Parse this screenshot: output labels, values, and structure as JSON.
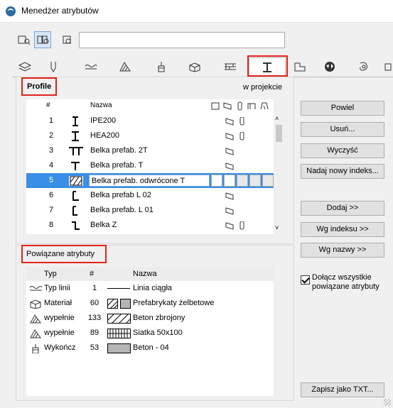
{
  "window": {
    "title": "Menedżer atrybutów"
  },
  "profiles": {
    "title": "Profile",
    "location_label": "w projekcie",
    "columns": {
      "num": "#",
      "name": "Nazwa"
    },
    "rows": [
      {
        "num": "1",
        "name": "IPE200",
        "icon": "i-beam-profile-icon"
      },
      {
        "num": "2",
        "name": "HEA200",
        "icon": "h-beam-profile-icon"
      },
      {
        "num": "3",
        "name": "Belka prefab. 2T",
        "icon": "double-t-profile-icon"
      },
      {
        "num": "4",
        "name": "Belka prefab. T",
        "icon": "t-profile-icon"
      },
      {
        "num": "5",
        "name": "Belka prefab. odwrócone T",
        "icon": "hatched-profile-icon",
        "selected": true
      },
      {
        "num": "6",
        "name": "Belka prefab L 02",
        "icon": "l-profile-icon"
      },
      {
        "num": "7",
        "name": "Belka prefab. L 01",
        "icon": "l-profile-icon"
      },
      {
        "num": "8",
        "name": "Belka Z",
        "icon": "z-profile-icon"
      }
    ]
  },
  "buttons": {
    "duplicate": "Powiel",
    "delete": "Usuń...",
    "clear": "Wyczyść",
    "reindex": "Nadaj nowy indeks...",
    "add": "Dodaj >>",
    "by_index": "Wg indeksu >>",
    "by_name": "Wg nazwy >>",
    "save_txt": "Zapisz jako TXT..."
  },
  "related": {
    "title": "Powiązane atrybuty",
    "columns": {
      "type": "Typ",
      "num": "#",
      "name": "Nazwa"
    },
    "rows": [
      {
        "type": "Typ linii",
        "num": "1",
        "name": "Linia ciągła"
      },
      {
        "type": "Materiał",
        "num": "60",
        "name": "Prefabrykaty żelbetowe"
      },
      {
        "type": "wypełnie",
        "num": "133",
        "name": "Beton zbrojony"
      },
      {
        "type": "wypełnie",
        "num": "89",
        "name": "Siatka 50x100"
      },
      {
        "type": "Wykończ",
        "num": "53",
        "name": "Beton - 04"
      }
    ]
  },
  "include_all_label": "Dołącz wszystkie powiązane atrybuty",
  "colors": {
    "selection": "#3a8ee6",
    "highlight_box": "#e2231a"
  }
}
